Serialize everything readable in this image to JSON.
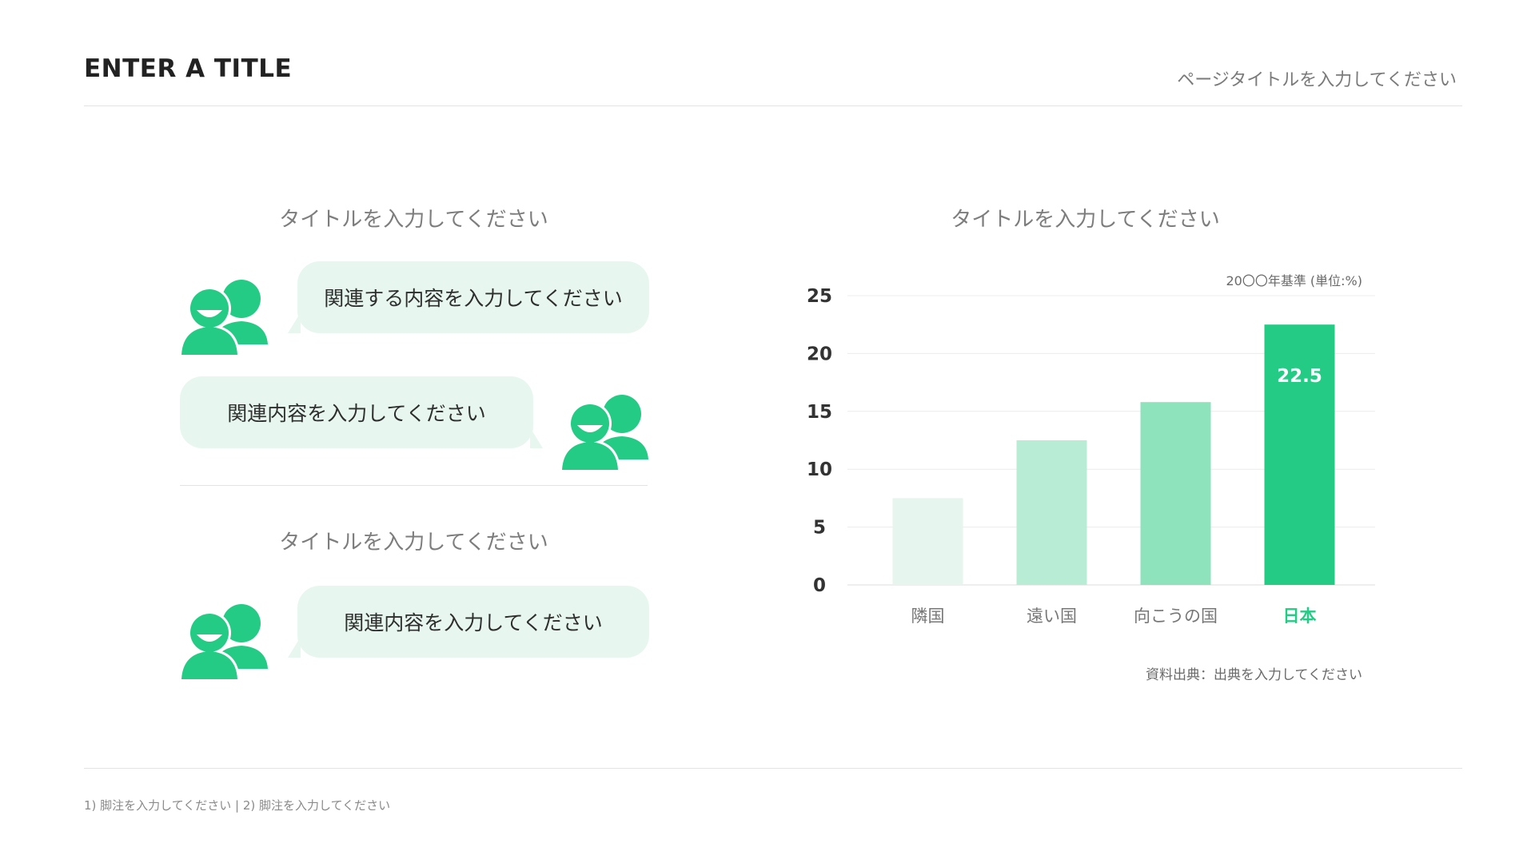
{
  "header": {
    "title": "ENTER A TITLE",
    "page_title": "ページタイトルを入力してください"
  },
  "left": {
    "section1_title": "タイトルを入力してください",
    "messages": [
      "関連する内容を入力してください",
      "関連内容を入力してください"
    ],
    "section2_title": "タイトルを入力してください",
    "message3": "関連内容を入力してください"
  },
  "chart": {
    "title": "タイトルを入力してください",
    "note": "20〇〇年基準 (単位:%)",
    "source": "資料出典：出典を入力してください"
  },
  "chart_data": {
    "type": "bar",
    "categories": [
      "隣国",
      "遠い国",
      "向こうの国",
      "日本"
    ],
    "values": [
      7.5,
      12.5,
      15.8,
      22.5
    ],
    "data_labels": [
      "",
      "",
      "",
      "22.5"
    ],
    "highlight_category": "日本",
    "ylim": [
      0,
      25
    ],
    "yticks": [
      0,
      5,
      10,
      15,
      20,
      25
    ],
    "grid": true,
    "bar_colors": [
      "#e6f6ee",
      "#b8ecd5",
      "#8ee3bc",
      "#24cb84"
    ],
    "highlight_color": "#24cb84",
    "axis_label_color": "#777777"
  },
  "colors": {
    "accent": "#24cb84",
    "bubble": "#e7f7ef"
  },
  "footer": {
    "footnote": "1) 脚注を入力してください | 2) 脚注を入力してください"
  }
}
